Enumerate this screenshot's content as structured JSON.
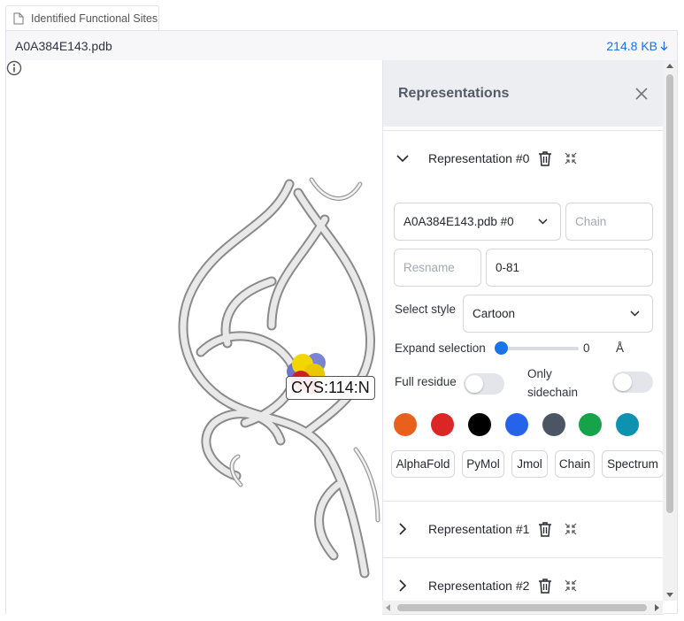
{
  "tab": {
    "label": "Identified Functional Sites",
    "icon": "document-icon"
  },
  "file": {
    "name": "A0A384E143.pdb",
    "size": "214.8 KB"
  },
  "viewer": {
    "hover_label": "CYS:114:N"
  },
  "panel": {
    "title": "Representations",
    "rep0": {
      "title": "Representation #0",
      "model_select": "A0A384E143.pdb #0",
      "chain_placeholder": "Chain",
      "resname_placeholder": "Resname",
      "residue_range": "0-81",
      "style_label": "Select style",
      "style_value": "Cartoon",
      "expand_label": "Expand selection",
      "expand_value": "0",
      "expand_unit": "Å",
      "full_residue_label": "Full residue",
      "only_sidechain_label_1": "Only",
      "only_sidechain_label_2": "sidechain",
      "full_residue_on": false,
      "only_sidechain_on": false,
      "colors": [
        "#e8601c",
        "#dc2626",
        "#000000",
        "#2563eb",
        "#4b5563",
        "#16a34a",
        "#0e92b0"
      ],
      "schemes": [
        "AlphaFold",
        "PyMol",
        "Jmol",
        "Chain",
        "Spectrum"
      ]
    },
    "rep1": {
      "title": "Representation #1"
    },
    "rep2": {
      "title": "Representation #2"
    }
  },
  "colors": {
    "accent": "#1a73e8",
    "panel_header_bg": "#eceef2"
  }
}
